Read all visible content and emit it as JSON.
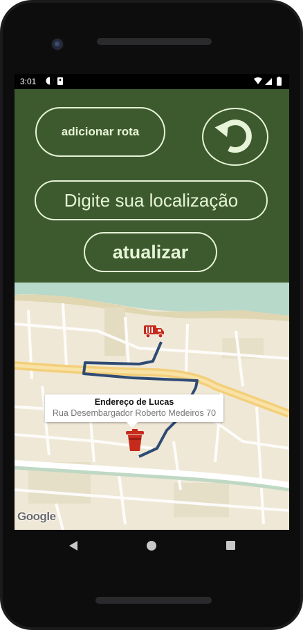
{
  "status_bar": {
    "time": "3:01"
  },
  "toolbar": {
    "add_route_label": "adicionar rota",
    "location_placeholder": "Digite sua localização",
    "update_label": "atualizar"
  },
  "map": {
    "info_window": {
      "title": "Endereço de Lucas",
      "subtitle": "Rua Desembargador Roberto Medeiros 70"
    },
    "attribution": "Google",
    "route_color": "#2f4b74",
    "marker_color": "#c62a1b"
  },
  "colors": {
    "app_background": "#3d5a2e",
    "button_outline": "#e6f4d7"
  },
  "icons": {
    "refresh": "refresh-icon",
    "truck_marker": "garbage-truck-icon",
    "trash_marker": "trash-bin-icon"
  }
}
